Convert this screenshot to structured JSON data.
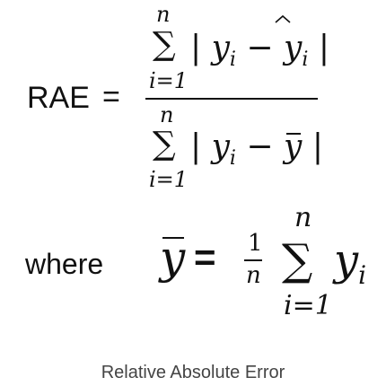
{
  "rae": {
    "label": "RAE",
    "equals": "=",
    "numerator": {
      "upper": "n",
      "sigma": "∑",
      "lower": "i=1",
      "expression": "| y",
      "sub_i": "i",
      "minus": "−",
      "y_hat": "y",
      "sub_i2": "i",
      "close_bar": "|"
    },
    "denominator": {
      "upper": "n",
      "sigma": "∑",
      "lower": "i=1",
      "expression": "| y",
      "sub_i": "i",
      "minus": "−",
      "y_bar": "y",
      "close_bar": "|"
    }
  },
  "where": {
    "label": "where",
    "y_bar": "y",
    "equals": "=",
    "frac_num": "1",
    "frac_den": "n",
    "upper": "n",
    "sigma": "∑",
    "term": "y",
    "sub_i": "i",
    "lower": "i=1"
  },
  "caption": "Relative Absolute Error"
}
